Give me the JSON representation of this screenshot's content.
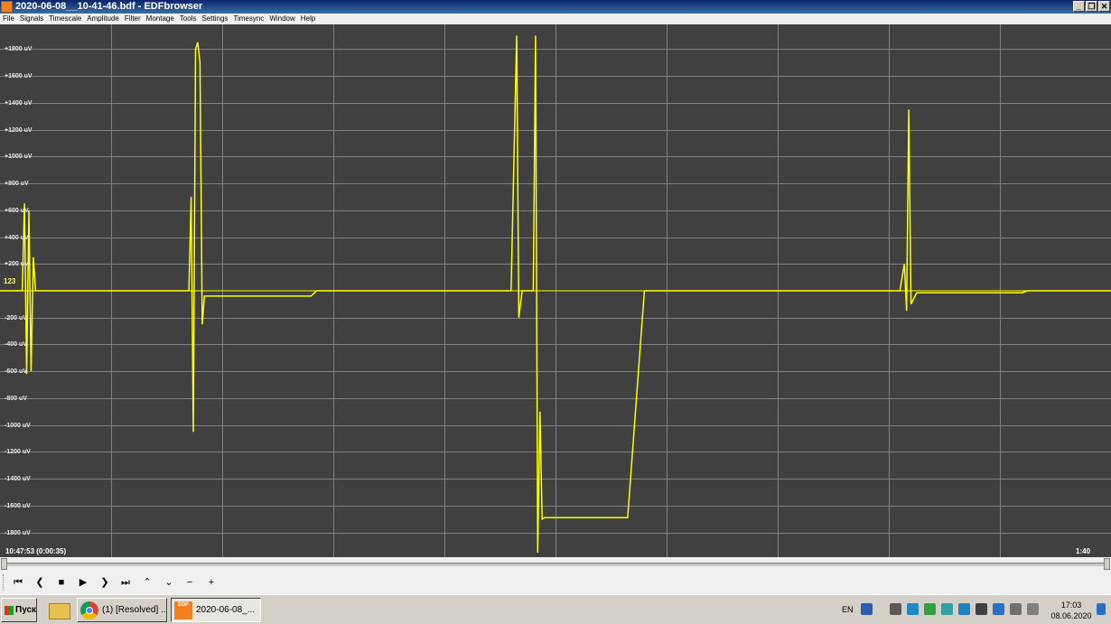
{
  "window": {
    "title": "2020-06-08__10-41-46.bdf - EDFbrowser",
    "controls": [
      "_",
      "❐",
      "✕"
    ]
  },
  "menu": [
    "File",
    "Signals",
    "Timescale",
    "Amplitude",
    "Filter",
    "Montage",
    "Tools",
    "Settings",
    "Timesync",
    "Window",
    "Help"
  ],
  "viewer": {
    "background": "#404040",
    "trace_color": "#ffff00",
    "grid_color": "#808080",
    "channel_label": "123",
    "time_start": "10:47:53 (0:00:35)",
    "time_end": "1:40",
    "y_ticks": [
      "+1800 uV",
      "+1600 uV",
      "+1400 uV",
      "+1200 uV",
      "+1000 uV",
      "+800 uV",
      "+600 uV",
      "+400 uV",
      "+200 uV",
      "-200 uV",
      "-400 uV",
      "-600 uV",
      "-800 uV",
      "-1000 uV",
      "-1200 uV",
      "-1400 uV",
      "-1600 uV",
      "-1800 uV"
    ]
  },
  "chart_data": {
    "type": "line",
    "units": "uV",
    "ylim": [
      -1950,
      1950
    ],
    "grid": true,
    "series": [
      {
        "points": [
          [
            0,
            0
          ],
          [
            0.02,
            0
          ],
          [
            0.022,
            650
          ],
          [
            0.024,
            -620
          ],
          [
            0.026,
            600
          ],
          [
            0.028,
            -600
          ],
          [
            0.03,
            250
          ],
          [
            0.032,
            0
          ],
          [
            0.17,
            0
          ],
          [
            0.172,
            700
          ],
          [
            0.174,
            -1050
          ],
          [
            0.176,
            1800
          ],
          [
            0.178,
            1850
          ],
          [
            0.18,
            1700
          ],
          [
            0.182,
            -250
          ],
          [
            0.184,
            -40
          ],
          [
            0.27,
            -40
          ],
          [
            0.275,
            -40
          ],
          [
            0.28,
            -40
          ],
          [
            0.285,
            0
          ],
          [
            0.46,
            0
          ],
          [
            0.465,
            1900
          ],
          [
            0.467,
            -200
          ],
          [
            0.47,
            0
          ],
          [
            0.48,
            0
          ],
          [
            0.482,
            1900
          ],
          [
            0.484,
            -1950
          ],
          [
            0.486,
            -900
          ],
          [
            0.488,
            -1700
          ],
          [
            0.49,
            -1690
          ],
          [
            0.52,
            -1690
          ],
          [
            0.565,
            -1690
          ],
          [
            0.58,
            0
          ],
          [
            0.81,
            0
          ],
          [
            0.814,
            200
          ],
          [
            0.816,
            -150
          ],
          [
            0.818,
            1350
          ],
          [
            0.82,
            -100
          ],
          [
            0.825,
            -15
          ],
          [
            0.92,
            -15
          ],
          [
            0.925,
            0
          ],
          [
            1.0,
            0
          ]
        ]
      }
    ]
  },
  "navigation": [
    "⏮",
    "❮",
    "■",
    "▶",
    "❯",
    "⏭",
    "⌃",
    "⌄",
    "−",
    "+"
  ],
  "taskbar": {
    "start_label": "Пуск",
    "tasks": [
      "(1) [Resolved] ...",
      "2020-06-08_..."
    ],
    "lang": "EN",
    "tray_colors": [
      "#2a5fb0",
      "#5a5a5a",
      "#1e88c8",
      "#30a040",
      "#30a0a0",
      "#2080c0",
      "#404040",
      "#2a6ec8",
      "#707070",
      "#808080"
    ],
    "time": "17:03",
    "date": "08.06.2020"
  }
}
